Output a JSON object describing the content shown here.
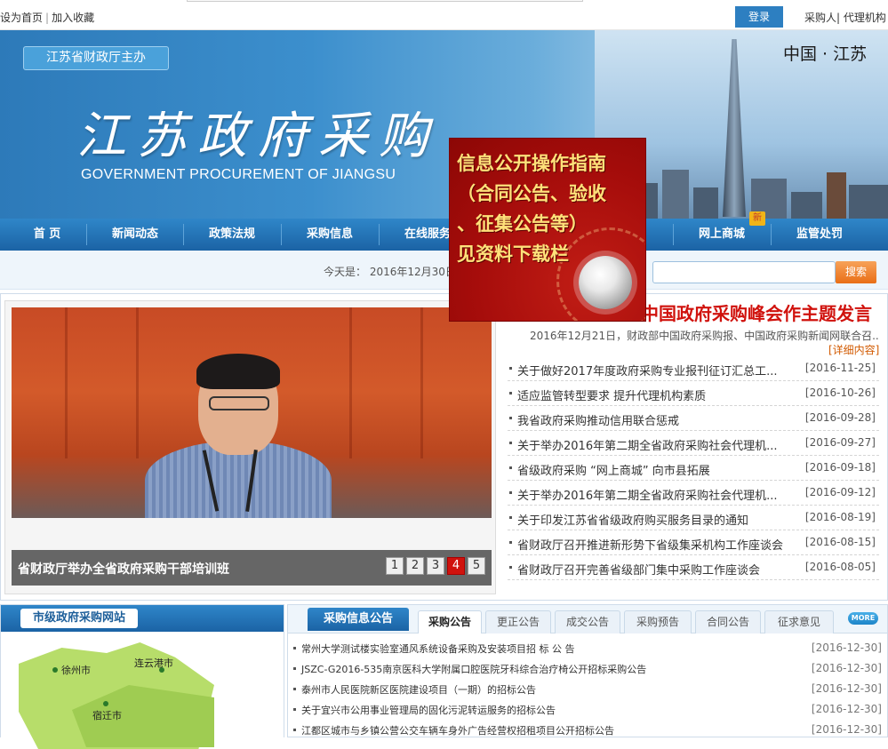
{
  "topbar": {
    "set_home": "设为首页",
    "sep": "|",
    "favorite": "加入收藏",
    "login": "登录",
    "roles": "采购人| 代理机构"
  },
  "banner": {
    "host_tag": "江苏省财政厅主办",
    "region": "中国 · 江苏",
    "title": "江苏政府采购",
    "subtitle": "GOVERNMENT PROCUREMENT OF JIANGSU"
  },
  "nav": {
    "items": [
      "首 页",
      "新闻动态",
      "政策法规",
      "采购信息",
      "在线服务",
      "",
      "网上商城",
      "监管处罚"
    ],
    "new_badge": "新"
  },
  "datebar": {
    "today": "今天是： 2016年12月30日",
    "search_button": "搜索",
    "search_placeholder": ""
  },
  "popup": {
    "lines": [
      "信息公开操作指南",
      "（合同公告、验收",
      "、征集公告等）",
      "见资料下载栏"
    ]
  },
  "slideshow": {
    "caption": "省财政厅举办全省政府采购干部培训班",
    "pages": [
      "1",
      "2",
      "3",
      "4",
      "5"
    ],
    "active_page": 4
  },
  "headline": {
    "title": "中国政府采购峰会作主题发言",
    "summary": "2016年12月21日，财政部中国政府采购报、中国政府采购新闻网联合召...",
    "detail_link": "[详细内容]"
  },
  "news": [
    {
      "title": "关于做好2017年度政府采购专业报刊征订汇总工...",
      "date": "[2016-11-25]"
    },
    {
      "title": "适应监管转型要求 提升代理机构素质",
      "date": "[2016-10-26]"
    },
    {
      "title": "我省政府采购推动信用联合惩戒",
      "date": "[2016-09-28]"
    },
    {
      "title": "关于举办2016年第二期全省政府采购社会代理机...",
      "date": "[2016-09-27]"
    },
    {
      "title": "省级政府采购 “网上商城” 向市县拓展",
      "date": "[2016-09-18]"
    },
    {
      "title": "关于举办2016年第二期全省政府采购社会代理机...",
      "date": "[2016-09-12]"
    },
    {
      "title": "关于印发江苏省省级政府购买服务目录的通知",
      "date": "[2016-08-19]"
    },
    {
      "title": "省财政厅召开推进新形势下省级集采机构工作座谈会",
      "date": "[2016-08-15]"
    },
    {
      "title": "省财政厅召开完善省级部门集中采购工作座谈会",
      "date": "[2016-08-05]"
    }
  ],
  "city_panel": {
    "title": "市级政府采购网站",
    "cities": [
      "徐州市",
      "连云港市",
      "宿迁市"
    ]
  },
  "proc_panel": {
    "title": "采购信息公告",
    "tabs": [
      "采购公告",
      "更正公告",
      "成交公告",
      "采购预告",
      "合同公告",
      "征求意见"
    ],
    "active_tab": 0,
    "more": "MORE",
    "items": [
      {
        "title": "常州大学测试楼实验室通风系统设备采购及安装项目招 标 公 告",
        "date": "[2016-12-30]"
      },
      {
        "title": "JSZC-G2016-535南京医科大学附属口腔医院牙科综合治疗椅公开招标采购公告",
        "date": "[2016-12-30]"
      },
      {
        "title": "泰州市人民医院新区医院建设项目（一期）的招标公告",
        "date": "[2016-12-30]"
      },
      {
        "title": "关于宜兴市公用事业管理局的固化污泥转运服务的招标公告",
        "date": "[2016-12-30]"
      },
      {
        "title": "江都区城市与乡镇公营公交车辆车身外广告经营权招租项目公开招标公告",
        "date": "[2016-12-30]"
      }
    ]
  }
}
